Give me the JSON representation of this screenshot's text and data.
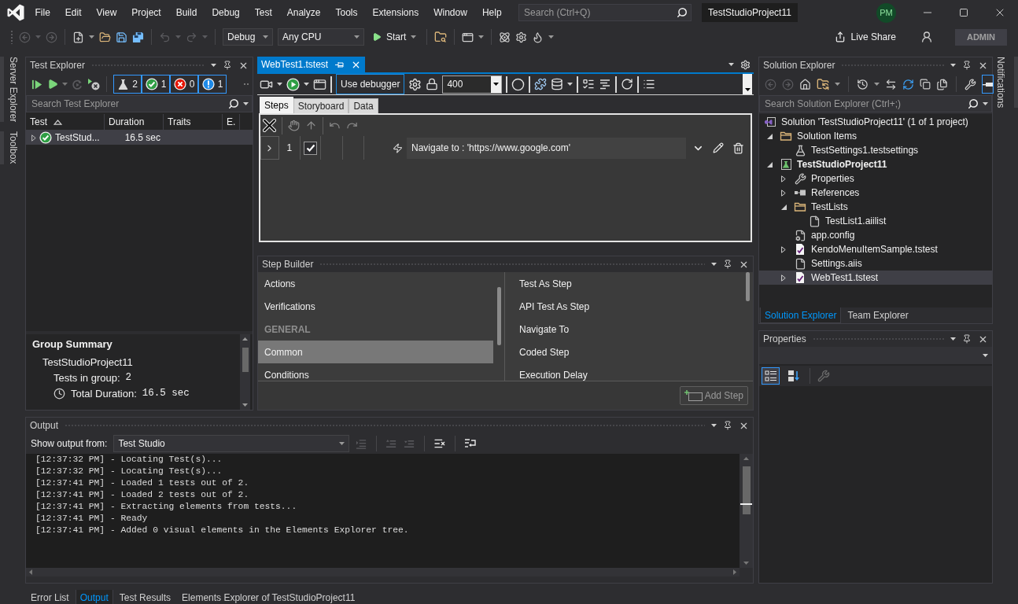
{
  "title_bar": {
    "menu": [
      "File",
      "Edit",
      "View",
      "Project",
      "Build",
      "Debug",
      "Test",
      "Analyze",
      "Tools",
      "Extensions",
      "Window",
      "Help"
    ],
    "search": {
      "placeholder": "Search (Ctrl+Q)"
    },
    "solution_name": "TestStudioProject11",
    "account_initials": "PM"
  },
  "toolbar": {
    "configuration": "Debug",
    "platform": "Any CPU",
    "start": "Start",
    "live_share": "Live Share",
    "account_badge": "ADMIN"
  },
  "left_side_tabs": [
    "Server Explorer",
    "Toolbox"
  ],
  "right_side_tabs": [
    "Notifications"
  ],
  "test_explorer": {
    "title": "Test Explorer",
    "filters": [
      {
        "kind": "total",
        "count": "2",
        "on": true
      },
      {
        "kind": "passed",
        "count": "1",
        "on": true
      },
      {
        "kind": "failed",
        "count": "0",
        "on": true
      },
      {
        "kind": "not_run",
        "count": "1",
        "on": true
      }
    ],
    "search": {
      "placeholder": "Search Test Explorer"
    },
    "columns": [
      {
        "label": "Test",
        "sorted": true
      },
      {
        "label": "Duration",
        "sorted": false
      },
      {
        "label": "Traits",
        "sorted": false
      },
      {
        "label": "E.",
        "sorted": false
      }
    ],
    "rows": [
      {
        "name": "TestStud...",
        "duration": "16.5 sec",
        "kind": "passed",
        "expanded": false,
        "selected": true
      }
    ],
    "summary": {
      "title": "Group Summary",
      "group": "TestStudioProject11",
      "stats": [
        {
          "kind": "count",
          "label": "Tests in group:",
          "value": "2"
        },
        {
          "kind": "duration",
          "label": "Total Duration:",
          "value": "16.5 sec"
        }
      ]
    }
  },
  "editor": {
    "tabs": [
      {
        "label": "WebTest1.tstest",
        "selected": true
      }
    ],
    "toolbar": {
      "debugger": {
        "label": "Use debugger",
        "on": true
      },
      "delay": "400"
    },
    "view_tabs": [
      {
        "label": "Steps",
        "selected": true
      },
      {
        "label": "Storyboard",
        "selected": false
      },
      {
        "label": "Data",
        "selected": false
      }
    ],
    "steps": [
      {
        "number": "1",
        "enabled": true,
        "expanded": false,
        "description": "Navigate to : 'https://www.google.com'"
      }
    ]
  },
  "step_builder": {
    "title": "Step Builder",
    "categories": [
      {
        "kind": "item",
        "label": "Actions",
        "selected": false
      },
      {
        "kind": "item",
        "label": "Verifications",
        "selected": false
      },
      {
        "kind": "header",
        "label": "GENERAL"
      },
      {
        "kind": "item",
        "label": "Common",
        "selected": true
      },
      {
        "kind": "item",
        "label": "Conditions",
        "selected": false
      }
    ],
    "steps": [
      "Test As Step",
      "API Test As Step",
      "Navigate To",
      "Coded Step",
      "Execution Delay"
    ],
    "add_button": {
      "label": "Add Step",
      "disabled": true
    }
  },
  "output": {
    "title": "Output",
    "source_label": "Show output from:",
    "source": "Test Studio",
    "lines": [
      "[12:37:32 PM] - Locating Test(s)...",
      "[12:37:32 PM] - Locating Test(s)...",
      "[12:37:41 PM] - Loaded 1 tests out of 2.",
      "[12:37:41 PM] - Loaded 2 tests out of 2.",
      "[12:37:41 PM] - Extracting elements from tests...",
      "[12:37:41 PM] - Ready",
      "[12:37:41 PM] - Added 0 visual elements in the Elements Explorer tree."
    ]
  },
  "bottom_tabs": [
    {
      "label": "Error List",
      "selected": false
    },
    {
      "label": "Output",
      "selected": true
    },
    {
      "label": "Test Results",
      "selected": false
    },
    {
      "label": "Elements Explorer of TestStudioProject11",
      "selected": false
    }
  ],
  "solution_explorer": {
    "title": "Solution Explorer",
    "toolbar_toggle": {
      "on": true
    },
    "search": {
      "placeholder": "Search Solution Explorer (Ctrl+;)"
    },
    "tree": [
      {
        "label": "Solution 'TestStudioProject11' (1 of 1 project)",
        "kind": "solution",
        "selected": false,
        "children": [
          {
            "label": "Solution Items",
            "kind": "folder",
            "expanded": true,
            "selected": false,
            "children": [
              {
                "label": "TestSettings1.testsettings",
                "kind": "settings",
                "selected": false
              }
            ]
          },
          {
            "label": "TestStudioProject11",
            "kind": "project",
            "expanded": true,
            "selected": false,
            "children": [
              {
                "label": "Properties",
                "kind": "properties",
                "expanded": false,
                "selected": false
              },
              {
                "label": "References",
                "kind": "references",
                "expanded": false,
                "selected": false
              },
              {
                "label": "TestLists",
                "kind": "folder",
                "expanded": true,
                "selected": false,
                "children": [
                  {
                    "label": "TestList1.aiilist",
                    "kind": "file",
                    "selected": false
                  }
                ]
              },
              {
                "label": "app.config",
                "kind": "config",
                "selected": false
              },
              {
                "label": "KendoMenuItemSample.tstest",
                "kind": "test",
                "expanded": false,
                "selected": false
              },
              {
                "label": "Settings.aiis",
                "kind": "file",
                "selected": false
              },
              {
                "label": "WebTest1.tstest",
                "kind": "test",
                "expanded": false,
                "selected": true
              }
            ]
          }
        ]
      }
    ],
    "tabs": [
      {
        "label": "Solution Explorer",
        "selected": true
      },
      {
        "label": "Team Explorer",
        "selected": false
      }
    ]
  },
  "properties": {
    "title": "Properties",
    "view_buttons": [
      {
        "kind": "categorized",
        "selected": true
      },
      {
        "kind": "alphabetical",
        "selected": false
      }
    ]
  }
}
